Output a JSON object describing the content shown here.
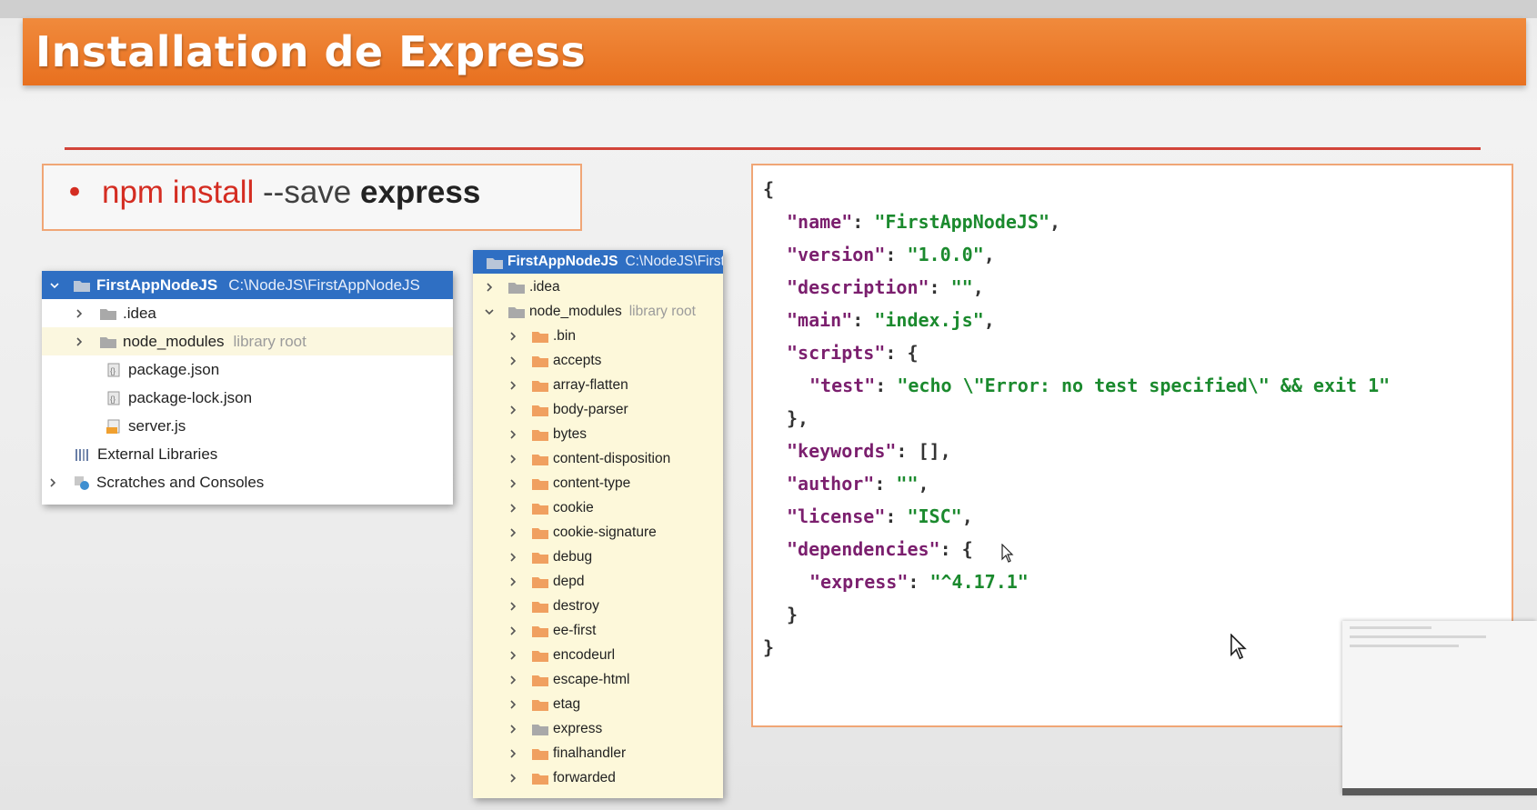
{
  "slide": {
    "title": "Installation de Express",
    "command": {
      "bullet": "•",
      "part1": "npm install",
      "part2": " --save ",
      "part3": "express"
    }
  },
  "tree1": {
    "project": "FirstAppNodeJS",
    "path": "C:\\NodeJS\\FirstAppNodeJS",
    "items": [
      {
        "label": ".idea",
        "sub": ""
      },
      {
        "label": "node_modules",
        "sub": "library root"
      },
      {
        "label": "package.json",
        "sub": ""
      },
      {
        "label": "package-lock.json",
        "sub": ""
      },
      {
        "label": "server.js",
        "sub": ""
      },
      {
        "label": "External Libraries",
        "sub": ""
      },
      {
        "label": "Scratches and Consoles",
        "sub": ""
      }
    ]
  },
  "tree2": {
    "project": "FirstAppNodeJS",
    "path": "C:\\NodeJS\\First",
    "idea": ".idea",
    "node_modules": "node_modules",
    "node_modules_sub": "library root",
    "folders": [
      ".bin",
      "accepts",
      "array-flatten",
      "body-parser",
      "bytes",
      "content-disposition",
      "content-type",
      "cookie",
      "cookie-signature",
      "debug",
      "depd",
      "destroy",
      "ee-first",
      "encodeurl",
      "escape-html",
      "etag",
      "express",
      "finalhandler",
      "forwarded"
    ]
  },
  "package_json": {
    "open": "{",
    "name_key": "\"name\"",
    "name_val": "\"FirstAppNodeJS\"",
    "version_key": "\"version\"",
    "version_val": "\"1.0.0\"",
    "description_key": "\"description\"",
    "description_val": "\"\"",
    "main_key": "\"main\"",
    "main_val": "\"index.js\"",
    "scripts_key": "\"scripts\"",
    "test_key": "\"test\"",
    "test_val": "\"echo \\\"Error: no test specified\\\" && exit 1\"",
    "keywords_key": "\"keywords\"",
    "author_key": "\"author\"",
    "author_val": "\"\"",
    "license_key": "\"license\"",
    "license_val": "\"ISC\"",
    "dependencies_key": "\"dependencies\"",
    "express_key": "\"express\"",
    "express_val": "\"^4.17.1\"",
    "close": "}"
  },
  "colors": {
    "title_bar": "#e8701f",
    "rule": "#d2453a",
    "selection": "#2f6fc3",
    "json_key": "#7b1f6e",
    "json_string": "#1b8a2e"
  }
}
